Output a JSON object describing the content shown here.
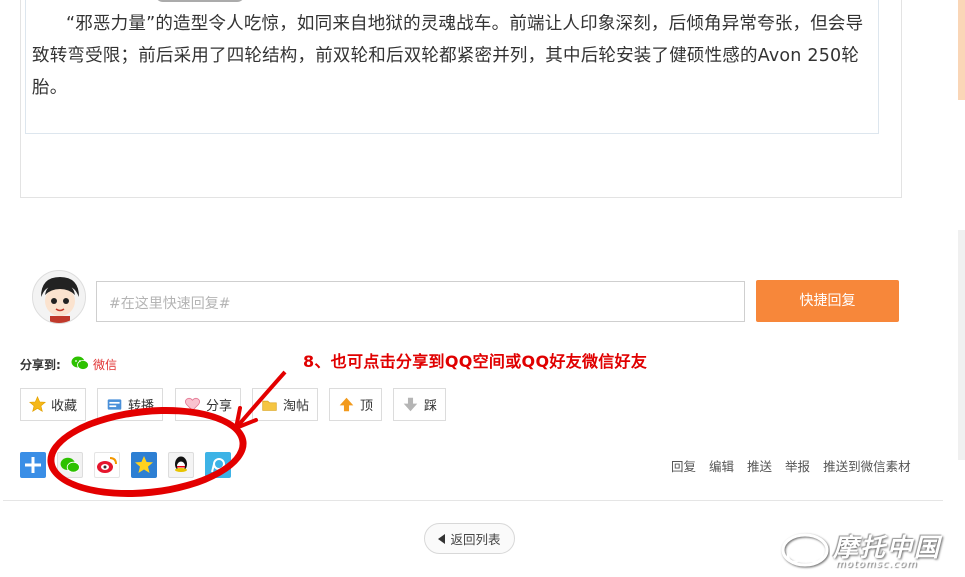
{
  "article": {
    "paragraph": "“邪恶力量”的造型令人吃惊，如同来自地狱的灵魂战车。前端让人印象深刻，后倾角异常夸张，但会导致转弯受限；前后采用了四轮结构，前双轮和后双轮都紧密并列，其中后轮安装了健硕性感的Avon 250轮胎。"
  },
  "reply": {
    "placeholder": "#在这里快速回复#",
    "button_label": "快捷回复"
  },
  "share": {
    "label": "分享到:",
    "wechat_label": "微信"
  },
  "annotation": "8、也可点击分享到QQ空间或QQ好友微信好友",
  "actions": [
    {
      "label": "收藏",
      "icon": "star-icon"
    },
    {
      "label": "转播",
      "icon": "repost-icon"
    },
    {
      "label": "分享",
      "icon": "heart-icon"
    },
    {
      "label": "淘帖",
      "icon": "folder-icon"
    },
    {
      "label": "顶",
      "icon": "up-arrow-icon"
    },
    {
      "label": "踩",
      "icon": "down-arrow-icon"
    }
  ],
  "social_icons": [
    "add-share-icon",
    "wechat-share-icon",
    "weibo-share-icon",
    "qzone-share-icon",
    "qq-share-icon",
    "tencent-weibo-share-icon"
  ],
  "post_links": [
    "回复",
    "编辑",
    "推送",
    "举报",
    "推送到微信素材"
  ],
  "back_button": "返回列表",
  "watermark": {
    "title": "摩托中国",
    "url": "motomsc.com"
  },
  "colors": {
    "accent": "#f7873a",
    "annotation_red": "#e00000",
    "wechat_green": "#2dc100"
  }
}
